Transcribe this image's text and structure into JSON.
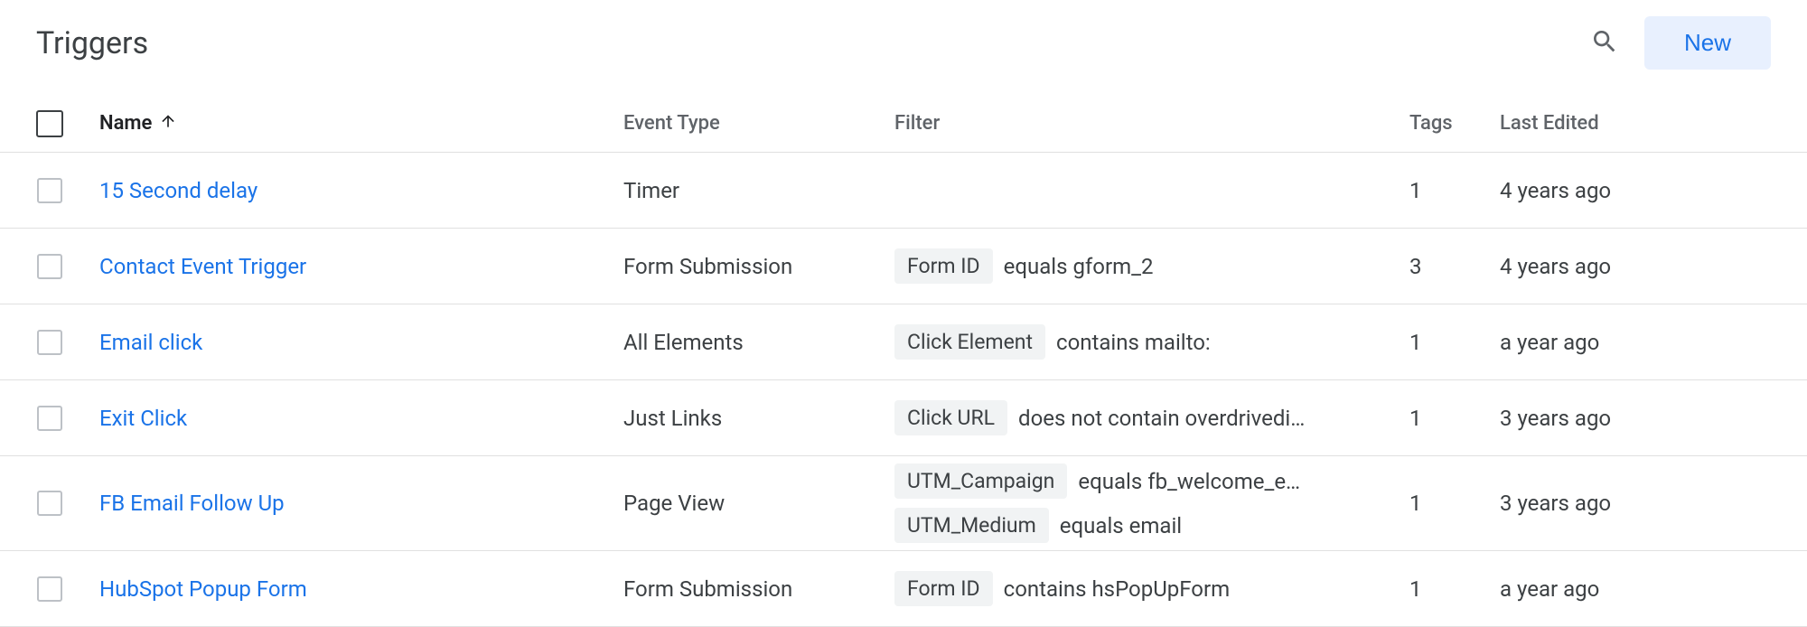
{
  "header": {
    "title": "Triggers",
    "new_label": "New"
  },
  "columns": {
    "name": "Name",
    "event_type": "Event Type",
    "filter": "Filter",
    "tags": "Tags",
    "last_edited": "Last Edited"
  },
  "sort": {
    "column": "name",
    "direction": "asc"
  },
  "rows": [
    {
      "name": "15 Second delay",
      "event_type": "Timer",
      "filters": [],
      "tags": "1",
      "last_edited": "4 years ago"
    },
    {
      "name": "Contact Event Trigger",
      "event_type": "Form Submission",
      "filters": [
        {
          "field": "Form ID",
          "rest": "equals gform_2"
        }
      ],
      "tags": "3",
      "last_edited": "4 years ago"
    },
    {
      "name": "Email click",
      "event_type": "All Elements",
      "filters": [
        {
          "field": "Click Element",
          "rest": "contains mailto:"
        }
      ],
      "tags": "1",
      "last_edited": "a year ago"
    },
    {
      "name": "Exit Click",
      "event_type": "Just Links",
      "filters": [
        {
          "field": "Click URL",
          "rest": "does not contain overdrivedi…"
        }
      ],
      "tags": "1",
      "last_edited": "3 years ago"
    },
    {
      "name": "FB Email Follow Up",
      "event_type": "Page View",
      "filters": [
        {
          "field": "UTM_Campaign",
          "rest": "equals fb_welcome_e…"
        },
        {
          "field": "UTM_Medium",
          "rest": "equals email"
        }
      ],
      "tags": "1",
      "last_edited": "3 years ago"
    },
    {
      "name": "HubSpot Popup Form",
      "event_type": "Form Submission",
      "filters": [
        {
          "field": "Form ID",
          "rest": "contains hsPopUpForm"
        }
      ],
      "tags": "1",
      "last_edited": "a year ago"
    }
  ]
}
